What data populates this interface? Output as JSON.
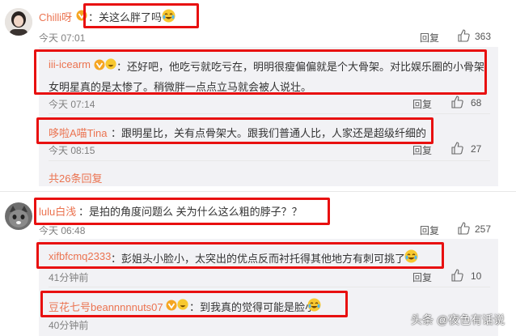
{
  "comments": [
    {
      "user": "Chilli呀",
      "text": "关这么胖了吗",
      "time": "今天 07:01",
      "reply": "回复",
      "likes": "363"
    },
    {
      "user": "lulu白浅",
      "text": "：是拍的角度问题么 关为什么这么粗的脖子？？",
      "time": "今天 06:48",
      "reply": "回复",
      "likes": "257"
    }
  ],
  "replies1": [
    {
      "user": "iii-icearm",
      "text_line1": "：还好吧，他吃亏就吃亏在，明明很瘦偏偏就是个大骨架。对比娱乐圈的小骨架",
      "text_line2": "女明星真的是太惨了。稍微胖一点点立马就会被人说壮。",
      "time": "今天 07:14",
      "reply": "回复",
      "likes": "68"
    },
    {
      "user": "哆啦A喵Tina",
      "text": "：跟明星比，关有点骨架大。跟我们普通人比，人家还是超级纤细的",
      "time": "今天 08:15",
      "reply": "回复",
      "likes": "27"
    }
  ],
  "more_replies": "共26条回复",
  "replies2": [
    {
      "user": "xifbfcmq2333",
      "text": "：彭姐头小脸小，太突出的优点反而衬托得其他地方有刺可挑了",
      "time": "41分钟前",
      "reply": "回复",
      "likes": "10"
    },
    {
      "user": "豆花七号beannnnnuts07",
      "text": "：到我真的觉得可能是脸小",
      "time": "40分钟前"
    }
  ],
  "watermark": "头条 @夜色有话说",
  "icons": [
    "avatar",
    "vip-badge",
    "laugh-cry-emoji",
    "thumbs-up-icon"
  ]
}
